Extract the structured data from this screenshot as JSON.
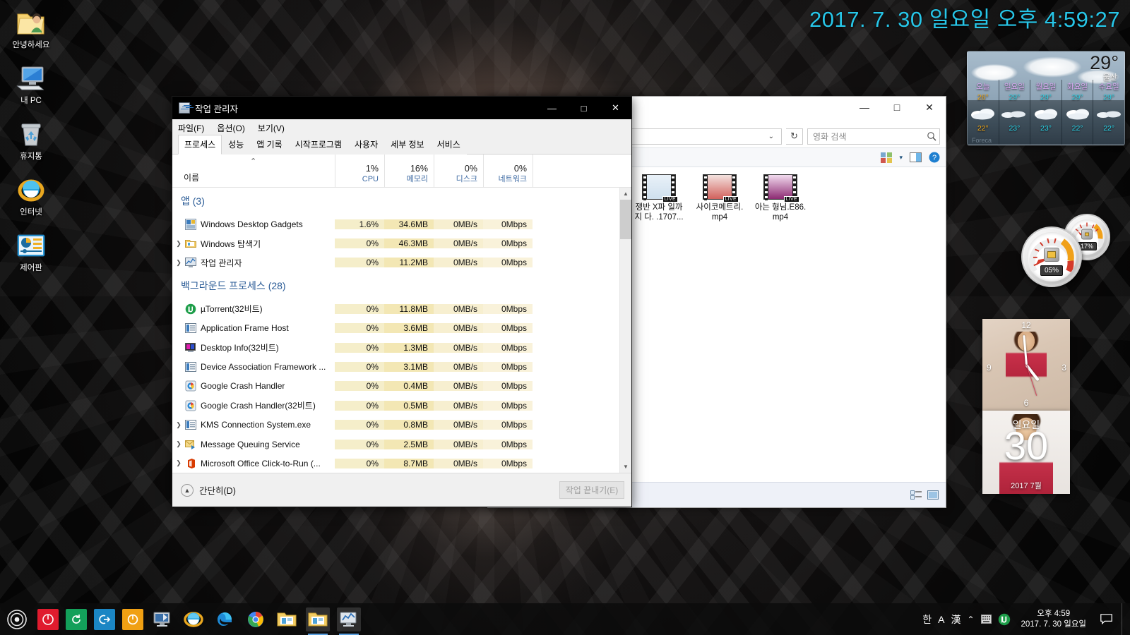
{
  "desktop": {
    "icons": [
      {
        "label": "안녕하세요",
        "icon": "folder-user-icon"
      },
      {
        "label": "내 PC",
        "icon": "computer-icon"
      },
      {
        "label": "휴지통",
        "icon": "recycle-bin-icon"
      },
      {
        "label": "인터넷",
        "icon": "internet-explorer-icon"
      },
      {
        "label": "제어판",
        "icon": "control-panel-icon"
      }
    ]
  },
  "top_clock": {
    "text": "2017. 7. 30 일요일 오후 4:59:27",
    "color": "#27c6e8"
  },
  "weather": {
    "current_temp": "29°",
    "city": "울산",
    "brand": "Foreca",
    "days": [
      {
        "name": "오늘",
        "high": "26°",
        "low": "22°",
        "high_color": "#f0a818",
        "low_color": "#f0a818",
        "icon": "cloudy-icon"
      },
      {
        "name": "일요일",
        "high": "29°",
        "low": "23°",
        "high_color": "#2bd4e8",
        "low_color": "#2bd4e8",
        "icon": "partly-cloudy-icon"
      },
      {
        "name": "월요일",
        "high": "29°",
        "low": "23°",
        "high_color": "#2bd4e8",
        "low_color": "#2bd4e8",
        "icon": "cloudy-icon"
      },
      {
        "name": "화요일",
        "high": "29°",
        "low": "22°",
        "high_color": "#2bd4e8",
        "low_color": "#2bd4e8",
        "icon": "cloudy-icon"
      },
      {
        "name": "수요일",
        "high": "29°",
        "low": "22°",
        "high_color": "#2bd4e8",
        "low_color": "#2bd4e8",
        "icon": "partly-cloudy-icon"
      }
    ]
  },
  "gauges": {
    "cpu": {
      "value": "05%",
      "icon": "cpu-chip-icon"
    },
    "ram": {
      "value": "17%",
      "icon": "memory-chip-icon"
    }
  },
  "clock_gadget": {
    "numbers": {
      "n12": "12",
      "n3": "3",
      "n6": "6",
      "n9": "9"
    }
  },
  "calendar_gadget": {
    "day_of_week": "일요일",
    "day_number": "30",
    "month": "2017 7월"
  },
  "explorer": {
    "title_buttons": {
      "minimize": "—",
      "maximize": "□",
      "close": "✕"
    },
    "address": {
      "value": "",
      "chevron": "⌄",
      "refresh": "↻"
    },
    "search": {
      "placeholder": "영화 검색",
      "icon": "search-icon"
    },
    "ribbon": {
      "view_icon": "view-layout-icon",
      "dropdown": "▾",
      "preview_icon": "preview-pane-icon",
      "help_icon": "help-icon"
    },
    "files": [
      {
        "name": "쟁반 X파\n일까지\n다.\n.1707...",
        "badge": "LIVE"
      },
      {
        "name": "사이코메트리.mp4",
        "badge": "LIVE"
      },
      {
        "name": "아는 형님.E86.mp4",
        "badge": "LIVE"
      }
    ],
    "status": {
      "details_view_icon": "details-view-icon",
      "large_icons_view_icon": "large-icons-view-icon"
    }
  },
  "task_manager": {
    "title": "작업 관리자",
    "title_icon": "task-manager-icon",
    "window_buttons": {
      "minimize": "—",
      "maximize": "□",
      "close": "✕"
    },
    "menu": [
      "파일(F)",
      "옵션(O)",
      "보기(V)"
    ],
    "tabs": [
      {
        "label": "프로세스",
        "active": true
      },
      {
        "label": "성능",
        "active": false
      },
      {
        "label": "앱 기록",
        "active": false
      },
      {
        "label": "시작프로그램",
        "active": false
      },
      {
        "label": "사용자",
        "active": false
      },
      {
        "label": "세부 정보",
        "active": false
      },
      {
        "label": "서비스",
        "active": false
      }
    ],
    "columns": {
      "name": "이름",
      "sort_arrow": "⌃",
      "metrics": [
        {
          "value": "1%",
          "name": "CPU"
        },
        {
          "value": "16%",
          "name": "메모리"
        },
        {
          "value": "0%",
          "name": "디스크"
        },
        {
          "value": "0%",
          "name": "네트워크"
        }
      ]
    },
    "rows": [
      {
        "type": "group",
        "name": "앱 (3)"
      },
      {
        "type": "proc",
        "expand": false,
        "name": "Windows Desktop Gadgets",
        "icon": "gadget-icon",
        "cpu": "1.6%",
        "mem": "34.6MB",
        "disk": "0MB/s",
        "net": "0Mbps",
        "cpu_hot": true
      },
      {
        "type": "proc",
        "expand": true,
        "name": "Windows 탐색기",
        "icon": "explorer-folder-icon",
        "cpu": "0%",
        "mem": "46.3MB",
        "disk": "0MB/s",
        "net": "0Mbps"
      },
      {
        "type": "proc",
        "expand": true,
        "name": "작업 관리자",
        "icon": "task-manager-icon",
        "cpu": "0%",
        "mem": "11.2MB",
        "disk": "0MB/s",
        "net": "0Mbps"
      },
      {
        "type": "group",
        "name": "백그라운드 프로세스 (28)"
      },
      {
        "type": "proc",
        "expand": false,
        "name": "µTorrent(32비트)",
        "icon": "utorrent-icon",
        "cpu": "0%",
        "mem": "11.8MB",
        "disk": "0MB/s",
        "net": "0Mbps"
      },
      {
        "type": "proc",
        "expand": false,
        "name": "Application Frame Host",
        "icon": "generic-app-icon",
        "cpu": "0%",
        "mem": "3.6MB",
        "disk": "0MB/s",
        "net": "0Mbps"
      },
      {
        "type": "proc",
        "expand": false,
        "name": "Desktop Info(32비트)",
        "icon": "desktop-info-icon",
        "cpu": "0%",
        "mem": "1.3MB",
        "disk": "0MB/s",
        "net": "0Mbps"
      },
      {
        "type": "proc",
        "expand": false,
        "name": "Device Association Framework ...",
        "icon": "generic-app-icon",
        "cpu": "0%",
        "mem": "3.1MB",
        "disk": "0MB/s",
        "net": "0Mbps"
      },
      {
        "type": "proc",
        "expand": false,
        "name": "Google Crash Handler",
        "icon": "google-crash-icon",
        "cpu": "0%",
        "mem": "0.4MB",
        "disk": "0MB/s",
        "net": "0Mbps"
      },
      {
        "type": "proc",
        "expand": false,
        "name": "Google Crash Handler(32비트)",
        "icon": "google-crash-icon",
        "cpu": "0%",
        "mem": "0.5MB",
        "disk": "0MB/s",
        "net": "0Mbps"
      },
      {
        "type": "proc",
        "expand": true,
        "name": "KMS Connection System.exe",
        "icon": "generic-app-icon",
        "cpu": "0%",
        "mem": "0.8MB",
        "disk": "0MB/s",
        "net": "0Mbps"
      },
      {
        "type": "proc",
        "expand": true,
        "name": "Message Queuing Service",
        "icon": "message-queue-icon",
        "cpu": "0%",
        "mem": "2.5MB",
        "disk": "0MB/s",
        "net": "0Mbps"
      },
      {
        "type": "proc",
        "expand": true,
        "name": "Microsoft Office Click-to-Run (...",
        "icon": "office-icon",
        "cpu": "0%",
        "mem": "8.7MB",
        "disk": "0MB/s",
        "net": "0Mbps"
      }
    ],
    "footer": {
      "less_details": "간단히(D)",
      "less_details_icon": "chevron-up-circle-icon",
      "end_task": "작업 끝내기(E)"
    }
  },
  "taskbar": {
    "start_icon": "start-orb-icon",
    "quick_launch": [
      {
        "icon": "shutdown-red-icon",
        "label": ""
      },
      {
        "icon": "restart-green-icon",
        "label": ""
      },
      {
        "icon": "logoff-blue-icon",
        "label": ""
      },
      {
        "icon": "sleep-orange-icon",
        "label": ""
      }
    ],
    "pinned": [
      {
        "icon": "desktop-monitor-icon",
        "open": false
      },
      {
        "icon": "internet-explorer-icon",
        "open": false
      },
      {
        "icon": "edge-icon",
        "open": false
      },
      {
        "icon": "chrome-icon",
        "open": false
      },
      {
        "icon": "file-explorer-icon",
        "open": false
      }
    ],
    "running": [
      {
        "icon": "file-explorer-icon",
        "open": true
      },
      {
        "icon": "task-manager-icon",
        "open": true
      }
    ],
    "tray": {
      "ime_korean": "한",
      "ime_alpha": "A",
      "ime_hanja": "漢",
      "overflow_chevron": "⌃",
      "keyboard_icon": "keyboard-icon",
      "utorrent_icon": "utorrent-tray-icon",
      "time": "오후 4:59",
      "date": "2017. 7. 30 일요일",
      "notification_icon": "notification-icon"
    }
  }
}
